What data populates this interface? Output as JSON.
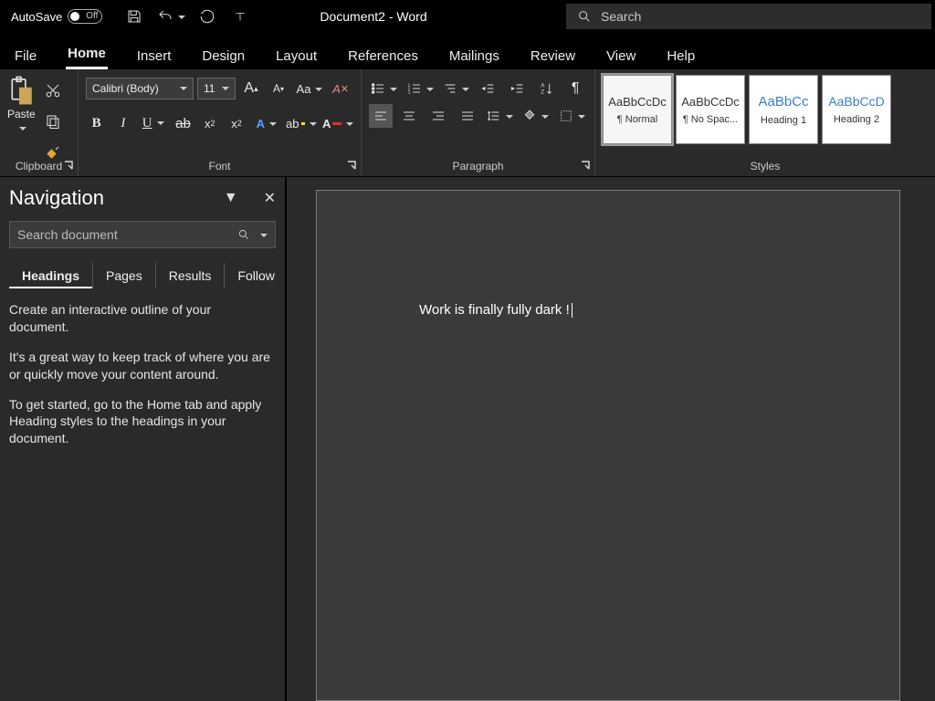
{
  "titlebar": {
    "autosave_label": "AutoSave",
    "autosave_state": "Off",
    "document_title": "Document2  -  Word",
    "search_placeholder": "Search"
  },
  "tabs": {
    "file": "File",
    "home": "Home",
    "insert": "Insert",
    "design": "Design",
    "layout": "Layout",
    "references": "References",
    "mailings": "Mailings",
    "review": "Review",
    "view": "View",
    "help": "Help"
  },
  "ribbon": {
    "clipboard": {
      "paste": "Paste",
      "label": "Clipboard"
    },
    "font": {
      "label": "Font",
      "font_name": "Calibri (Body)",
      "font_size": "11"
    },
    "paragraph": {
      "label": "Paragraph"
    },
    "styles": {
      "label": "Styles",
      "items": [
        {
          "preview": "AaBbCcDc",
          "name": "¶ Normal"
        },
        {
          "preview": "AaBbCcDc",
          "name": "¶ No Spac..."
        },
        {
          "preview": "AaBbCc",
          "name": "Heading 1"
        },
        {
          "preview": "AaBbCcD",
          "name": "Heading 2"
        }
      ]
    }
  },
  "nav": {
    "title": "Navigation",
    "search_placeholder": "Search document",
    "tabs": {
      "headings": "Headings",
      "pages": "Pages",
      "results": "Results",
      "follow": "Follow"
    },
    "para1": "Create an interactive outline of your document.",
    "para2": "It's a great way to keep track of where you are or quickly move your content around.",
    "para3": "To get started, go to the Home tab and apply Heading styles to the headings in your document."
  },
  "document": {
    "body_text": "Work is finally fully dark !"
  }
}
